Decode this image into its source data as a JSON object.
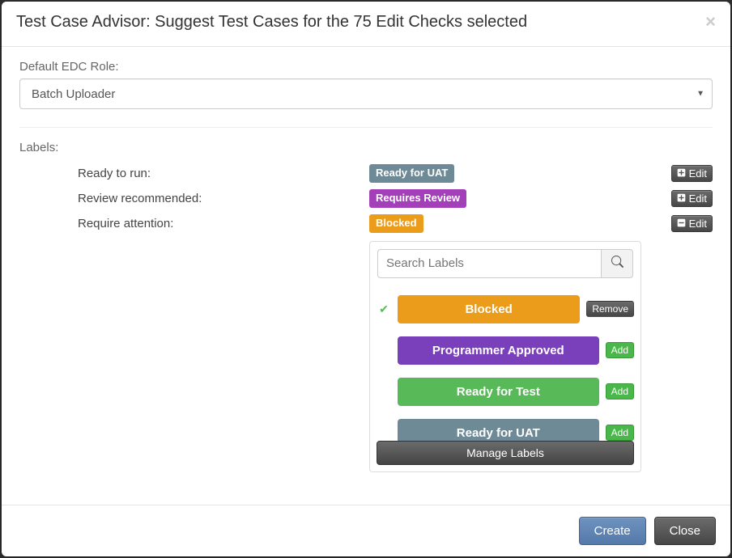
{
  "modal": {
    "title": "Test Case Advisor: Suggest Test Cases for the 75 Edit Checks selected",
    "close_glyph": "×"
  },
  "edc_role": {
    "label": "Default EDC Role:",
    "selected": "Batch Uploader"
  },
  "labels_section": {
    "heading": "Labels:",
    "rows": [
      {
        "caption": "Ready to run:",
        "badge": "Ready for UAT",
        "badge_class": "bg-slate",
        "edit_state": "collapsed"
      },
      {
        "caption": "Review recommended:",
        "badge": "Requires Review",
        "badge_class": "bg-purple",
        "edit_state": "collapsed"
      },
      {
        "caption": "Require attention:",
        "badge": "Blocked",
        "badge_class": "bg-orange",
        "edit_state": "expanded"
      }
    ],
    "edit_label": "Edit"
  },
  "labels_panel": {
    "search_placeholder": "Search Labels",
    "options": [
      {
        "name": "Blocked",
        "pill_class": "bg-orange",
        "selected": true,
        "action": "Remove"
      },
      {
        "name": "Programmer Approved",
        "pill_class": "bg-violet",
        "selected": false,
        "action": "Add"
      },
      {
        "name": "Ready for Test",
        "pill_class": "bg-green",
        "selected": false,
        "action": "Add"
      },
      {
        "name": "Ready for UAT",
        "pill_class": "bg-slate",
        "selected": false,
        "action": "Add"
      }
    ],
    "manage_label": "Manage Labels"
  },
  "footer": {
    "create": "Create",
    "close": "Close"
  }
}
